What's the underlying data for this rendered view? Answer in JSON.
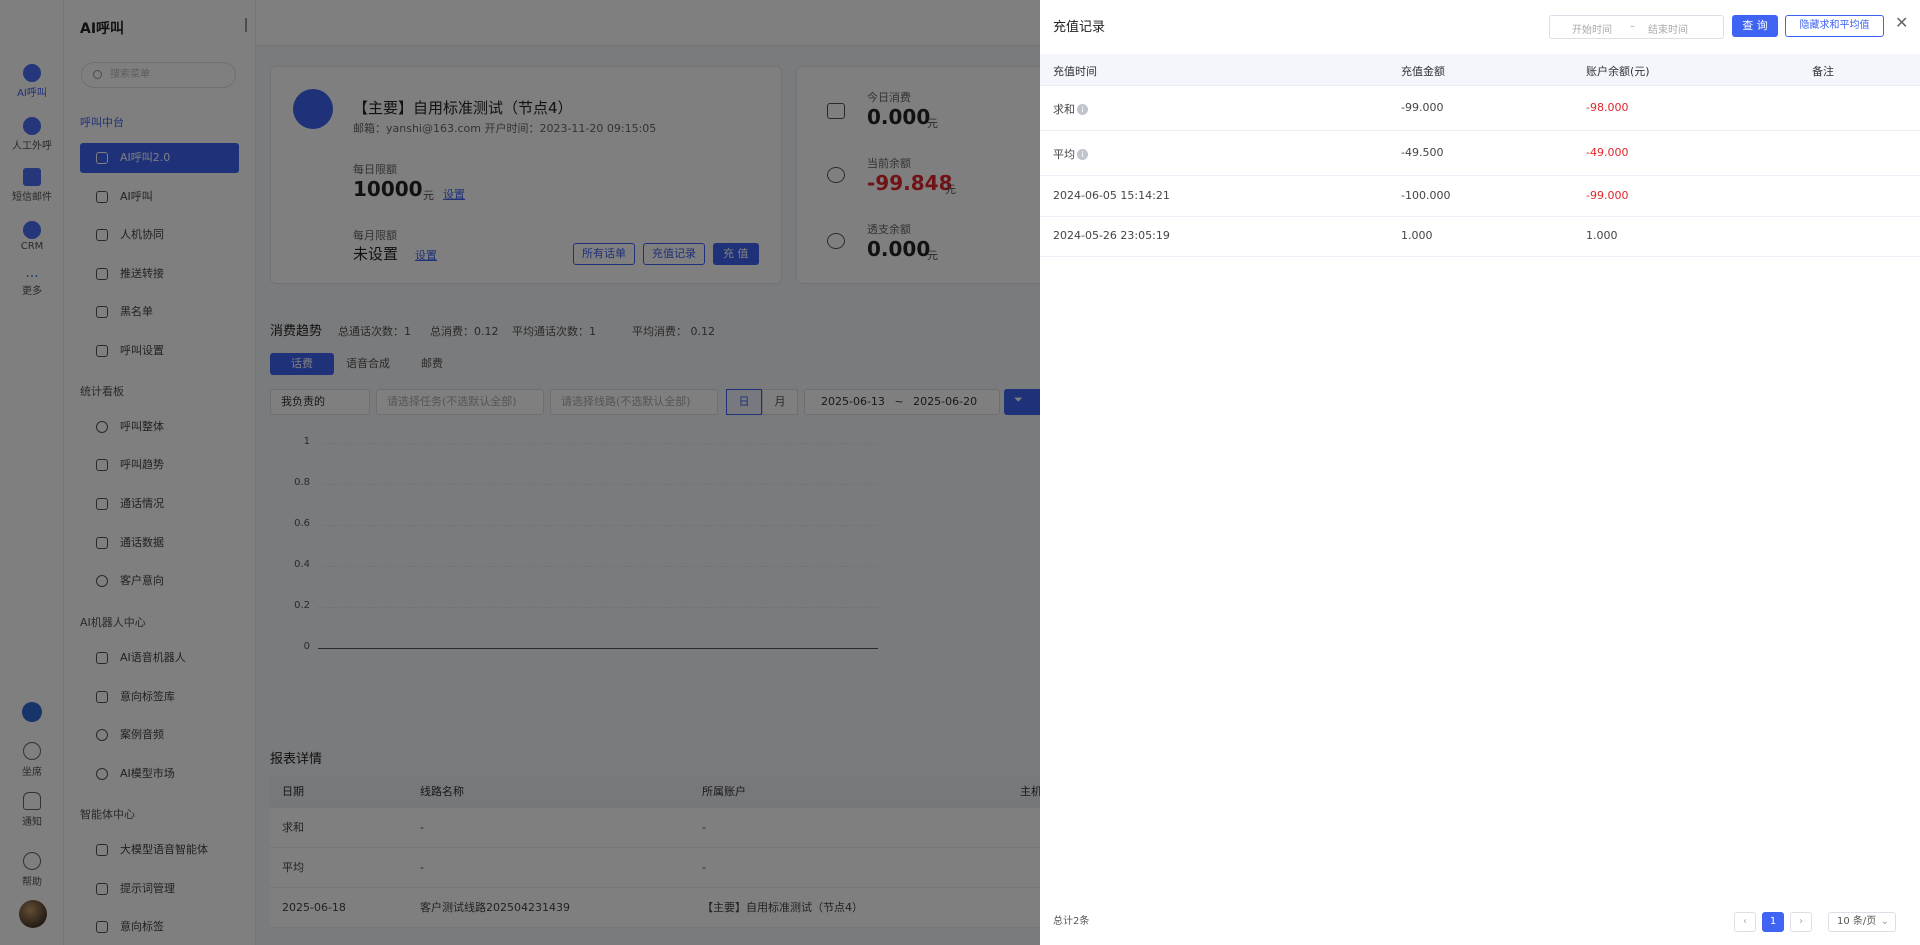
{
  "rail": {
    "items": [
      "AI呼叫",
      "人工外呼",
      "短信邮件",
      "CRM",
      "更多"
    ],
    "bottom": [
      "坐席",
      "通知",
      "帮助"
    ]
  },
  "sidebar": {
    "title": "AI呼叫",
    "search_placeholder": "搜索菜单",
    "groups": {
      "g1": "呼叫中台",
      "g2": "统计看板",
      "g3": "AI机器人中心",
      "g4": "智能体中心"
    },
    "items": {
      "i1": "AI呼叫2.0",
      "i2": "AI呼叫",
      "i3": "人机协同",
      "i4": "推送转接",
      "i5": "黑名单",
      "i6": "呼叫设置",
      "i7": "呼叫整体",
      "i8": "呼叫趋势",
      "i9": "通话情况",
      "i10": "通话数据",
      "i11": "客户意向",
      "i12": "AI语音机器人",
      "i13": "意向标签库",
      "i14": "案例音频",
      "i15": "AI模型市场",
      "i16": "大模型语音智能体",
      "i17": "提示词管理",
      "i18": "意向标签"
    }
  },
  "account": {
    "title": "【主要】自用标准测试（节点4）",
    "meta": "邮箱：yanshi@163.com    开户时间：2023-11-20 09:15:05",
    "daily_label": "每日限额",
    "daily_value": "10000",
    "unit": "元",
    "set_link": "设置",
    "monthly_label": "每月限额",
    "monthly_value": "未设置",
    "btn_bills": "所有话单",
    "btn_records": "充值记录",
    "btn_recharge": "充 值"
  },
  "balance": {
    "today_label": "今日消费",
    "today_value": "0.000",
    "current_label": "当前余额",
    "current_value": "-99.848",
    "overdraft_label": "透支余额",
    "overdraft_value": "0.000",
    "unit": "元"
  },
  "trend": {
    "title": "消费趋势",
    "stat1": "总通话次数：1",
    "stat2": "总消费：0.12",
    "stat3": "平均通话次数：1",
    "stat4": "平均消费：  0.12",
    "tabs": [
      "话费",
      "语音合成",
      "邮费"
    ],
    "filter_owner": "我负责的",
    "filter_task": "请选择任务(不选默认全部)",
    "filter_line": "请选择线路(不选默认全部)",
    "day": "日",
    "month": "月",
    "date_start": "2025-06-13",
    "date_sep": "~",
    "date_end": "2025-06-20",
    "yticks": [
      "1",
      "0.8",
      "0.6",
      "0.4",
      "0.2",
      "0"
    ]
  },
  "report": {
    "title": "报表详情",
    "headers": [
      "日期",
      "线路名称",
      "所属账户",
      "主机"
    ],
    "rows": [
      [
        "求和",
        "-",
        "-"
      ],
      [
        "平均",
        "-",
        "-"
      ],
      [
        "2025-06-18",
        "客户测试线路202504231439",
        "【主要】自用标准测试（节点4）"
      ]
    ]
  },
  "drawer": {
    "title": "充值记录",
    "range_start": "开始时间",
    "range_sep": "–",
    "range_end": "结束时间",
    "query": "查 询",
    "toggle": "隐藏求和平均值",
    "headers": [
      "充值时间",
      "充值金额",
      "账户余额(元)",
      "备注"
    ],
    "rows": [
      {
        "time": "求和",
        "amount": "-99.000",
        "balance": "-98.000"
      },
      {
        "time": "平均",
        "amount": "-49.500",
        "balance": "-49.000"
      },
      {
        "time": "2024-06-05 15:14:21",
        "amount": "-100.000",
        "balance": "-99.000"
      },
      {
        "time": "2024-05-26 23:05:19",
        "amount": "1.000",
        "balance": "1.000"
      }
    ],
    "total": "总计2条",
    "page": "1",
    "page_size": "10 条/页"
  }
}
